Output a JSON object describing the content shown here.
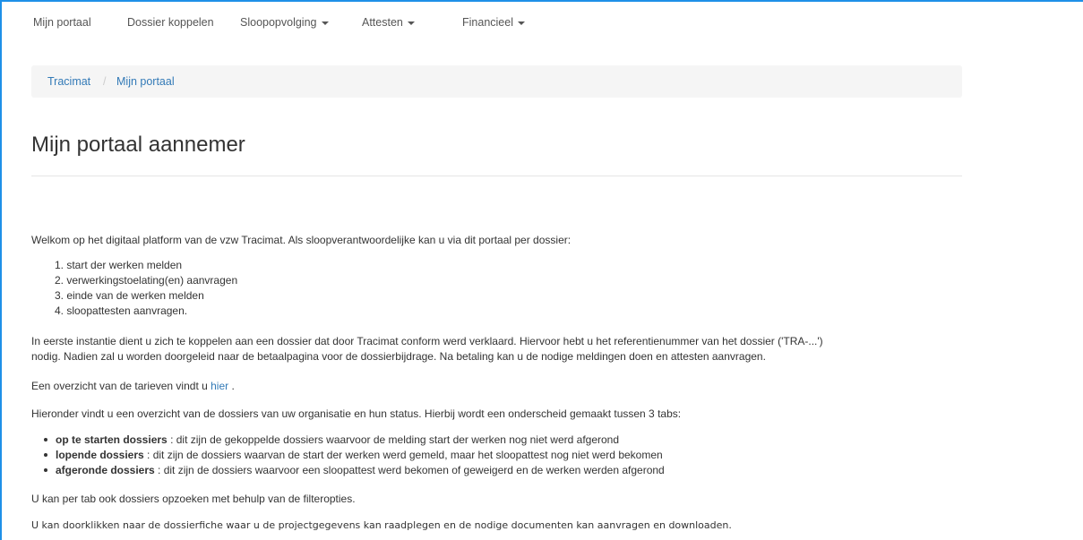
{
  "nav": {
    "items": [
      {
        "label": "Mijn portaal"
      },
      {
        "label": "Dossier koppelen"
      },
      {
        "label": "Sloopopvolging"
      },
      {
        "label": "Attesten"
      },
      {
        "label": "Financieel"
      }
    ]
  },
  "breadcrumb": {
    "root": "Tracimat",
    "separator": "/",
    "current": "Mijn portaal"
  },
  "page_title": "Mijn portaal aannemer",
  "intro": "Welkom op het digitaal platform van de vzw Tracimat. Als sloopverantwoordelijke kan u via dit portaal per dossier:",
  "steps": [
    "1. start der werken melden",
    "2. verwerkingstoelating(en) aanvragen",
    "3. einde van de werken melden",
    "4. sloopattesten aanvragen."
  ],
  "paragraph1_line1": "In eerste instantie dient u zich te koppelen aan een dossier dat door Tracimat conform werd verklaard. Hiervoor hebt u het referentienummer van het dossier ('TRA-...')",
  "paragraph1_line2": "nodig. Nadien zal u worden doorgeleid naar de betaalpagina voor de dossierbijdrage. Na betaling kan u de nodige meldingen doen en attesten aanvragen.",
  "tarieven": {
    "text": "Een overzicht van de tarieven vindt u",
    "link": "hier",
    "suffix": "."
  },
  "tabs_intro": "Hieronder vindt u een overzicht van de dossiers van uw organisatie en hun status. Hierbij wordt een onderscheid gemaakt tussen 3 tabs:",
  "tabs": [
    {
      "name": "op te starten dossiers",
      "desc": ": dit zijn de gekoppelde dossiers waarvoor de melding start der werken nog niet werd afgerond"
    },
    {
      "name": "lopende dossiers",
      "desc": ": dit zijn de dossiers waarvan de start der werken werd gemeld, maar het sloopattest nog niet werd bekomen"
    },
    {
      "name": "afgeronde dossiers",
      "desc": ": dit zijn de dossiers waarvoor een sloopattest werd bekomen of geweigerd en de werken werden afgerond"
    }
  ],
  "filter_text": "U kan per tab ook dossiers opzoeken met behulp van de filteropties.",
  "click_text": "U kan doorklikken naar de dossierfiche waar u de projectgegevens kan raadplegen en de nodige documenten kan aanvragen en downloaden.",
  "colors": {
    "link": "#337ab7",
    "frame": "#1e90e8",
    "breadcrumb_bg": "#f5f5f5"
  }
}
